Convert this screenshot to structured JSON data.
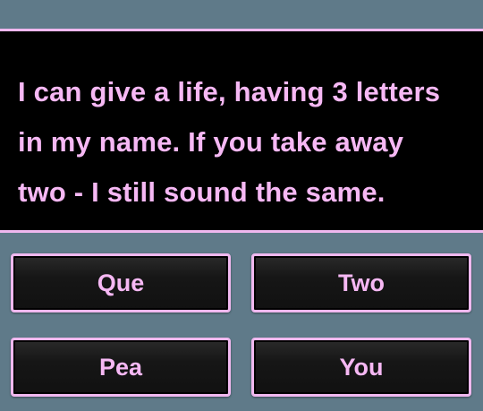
{
  "question": {
    "line1": "I can give a life, having 3 letters",
    "line2": "in my name. If you take away",
    "line3": "two - I still sound the same."
  },
  "answers": [
    {
      "label": "Que"
    },
    {
      "label": "Two"
    },
    {
      "label": "Pea"
    },
    {
      "label": "You"
    }
  ],
  "colors": {
    "background": "#5f7a89",
    "panel": "#000000",
    "accent": "#f0b8ef",
    "text": "#f6b8f4"
  }
}
